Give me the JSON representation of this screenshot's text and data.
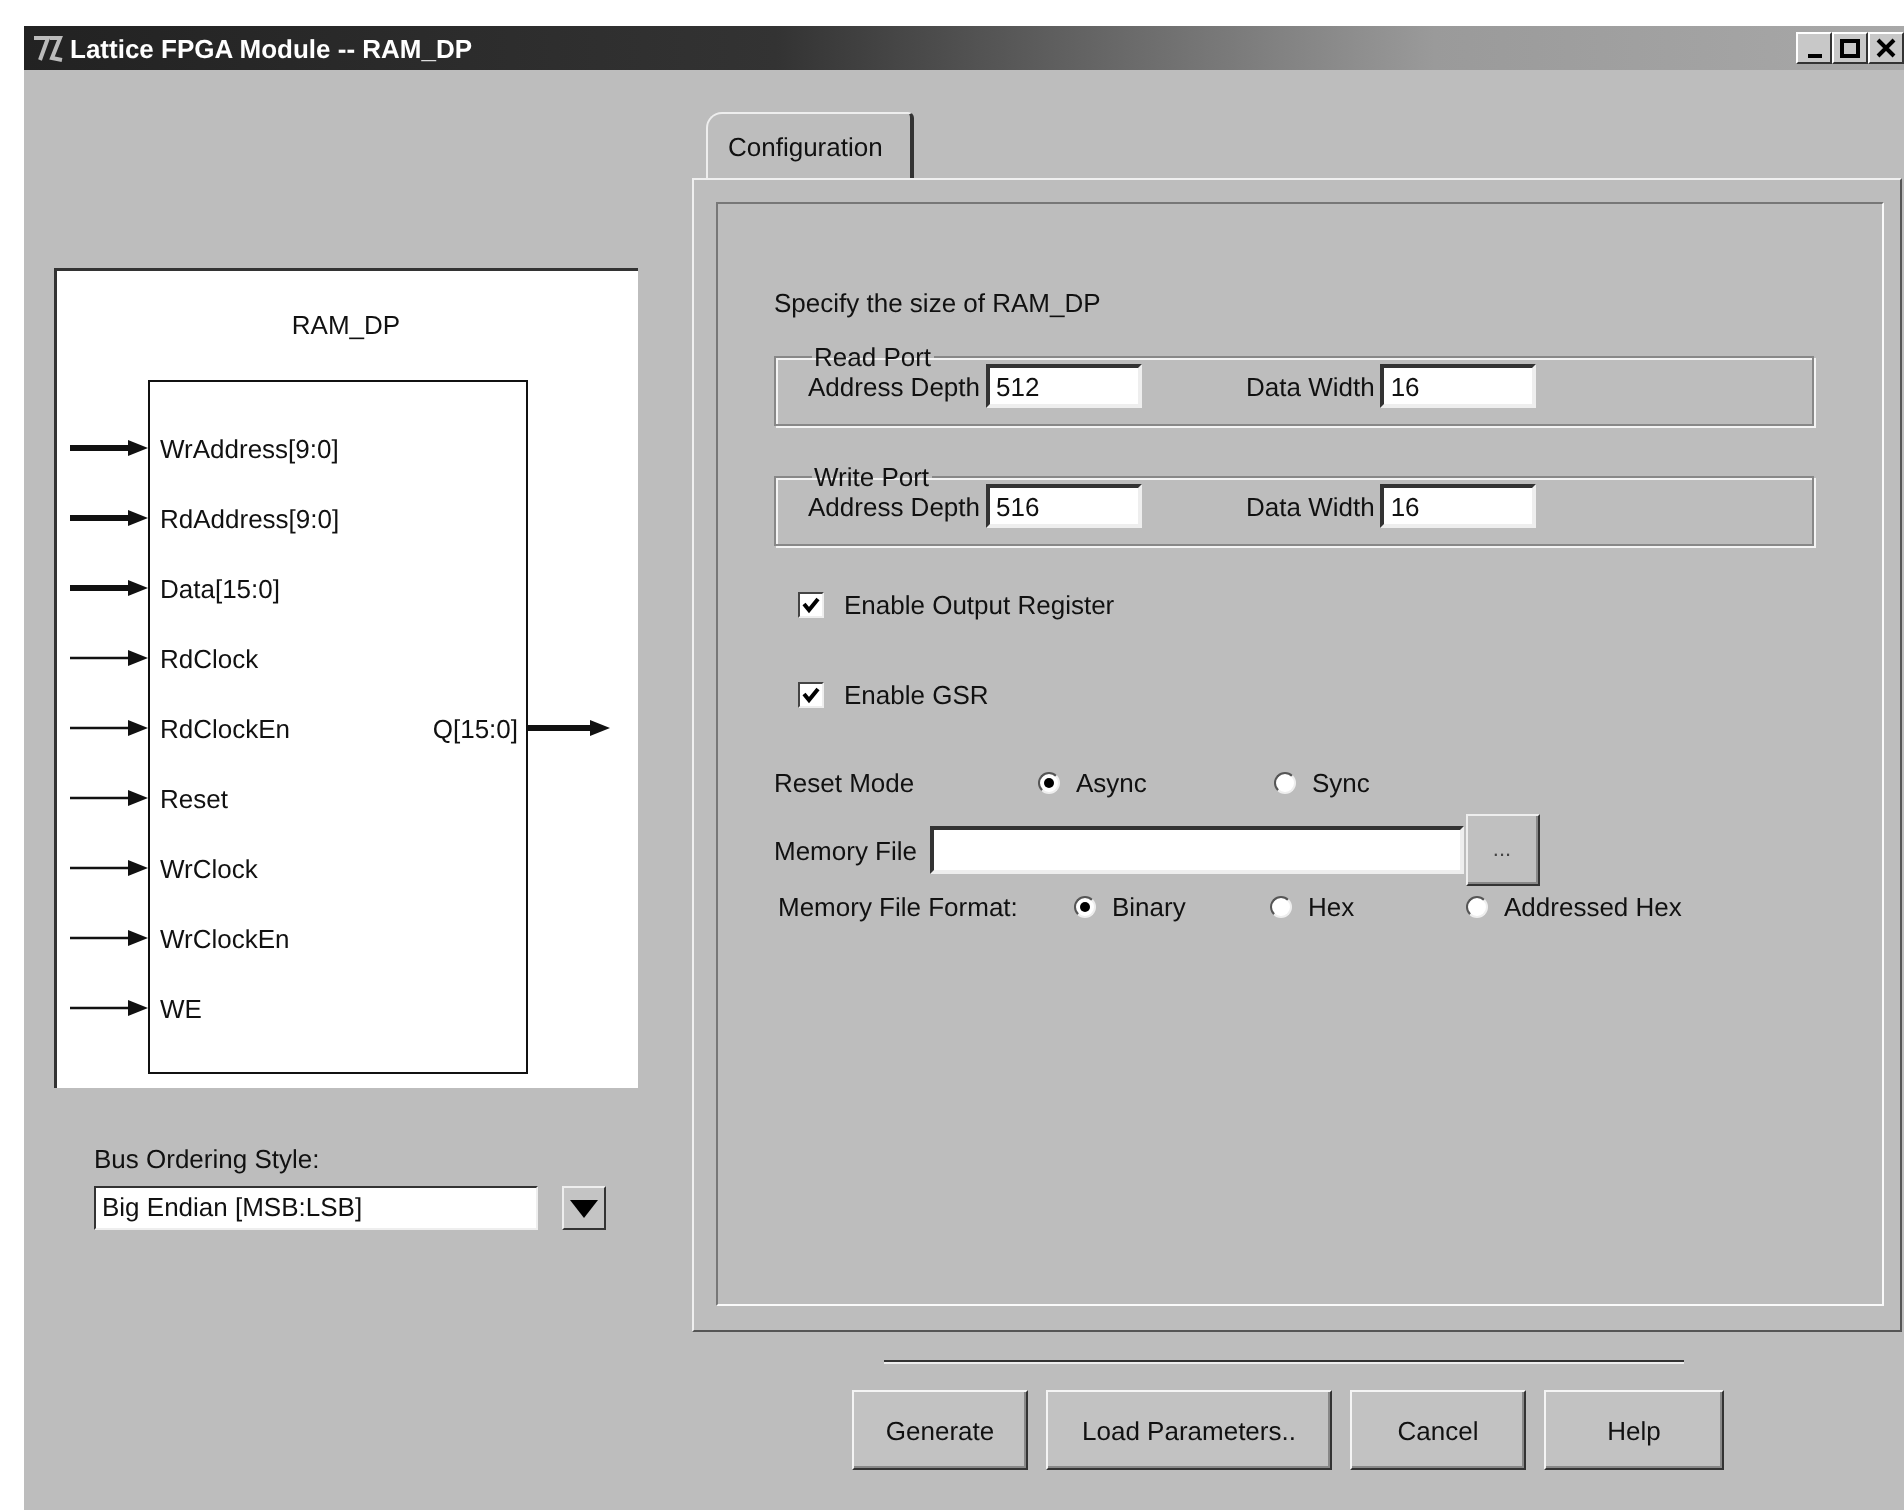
{
  "window": {
    "title": "Lattice FPGA Module -- RAM_DP"
  },
  "diagram": {
    "title": "RAM_DP",
    "inputs": [
      {
        "label": "WrAddress[9:0]",
        "kind": "bus"
      },
      {
        "label": "RdAddress[9:0]",
        "kind": "bus"
      },
      {
        "label": "Data[15:0]",
        "kind": "bus"
      },
      {
        "label": "RdClock",
        "kind": "single"
      },
      {
        "label": "RdClockEn",
        "kind": "single"
      },
      {
        "label": "Reset",
        "kind": "single"
      },
      {
        "label": "WrClock",
        "kind": "single"
      },
      {
        "label": "WrClockEn",
        "kind": "single"
      },
      {
        "label": "WE",
        "kind": "single"
      }
    ],
    "outputs": [
      {
        "label": "Q[15:0]",
        "kind": "bus"
      }
    ]
  },
  "bus_ordering": {
    "label": "Bus Ordering Style:",
    "value": "Big Endian [MSB:LSB]"
  },
  "tabs": [
    {
      "label": "Configuration",
      "selected": true
    }
  ],
  "config": {
    "heading": "Specify the size of RAM_DP",
    "ports": [
      {
        "title": "Read Port",
        "fields": [
          {
            "label": "Address Depth",
            "value": "512"
          },
          {
            "label": "Data Width",
            "value": "16"
          }
        ]
      },
      {
        "title": "Write Port",
        "fields": [
          {
            "label": "Address Depth",
            "value": "516"
          },
          {
            "label": "Data Width",
            "value": "16"
          }
        ]
      }
    ],
    "checkboxes": [
      {
        "label": "Enable Output Register",
        "checked": true
      },
      {
        "label": "Enable GSR",
        "checked": true
      }
    ],
    "reset_mode": {
      "label": "Reset Mode",
      "options": [
        {
          "label": "Async",
          "selected": true
        },
        {
          "label": "Sync",
          "selected": false
        }
      ]
    },
    "memory_file": {
      "label": "Memory File",
      "browse_button": "..."
    },
    "memory_file_format": {
      "label": "Memory File Format:",
      "options": [
        {
          "label": "Binary",
          "selected": true
        },
        {
          "label": "Hex",
          "selected": false
        },
        {
          "label": "Addressed Hex",
          "selected": false
        }
      ]
    }
  },
  "buttons": [
    "Generate",
    "Load Parameters..",
    "Cancel",
    "Help"
  ]
}
